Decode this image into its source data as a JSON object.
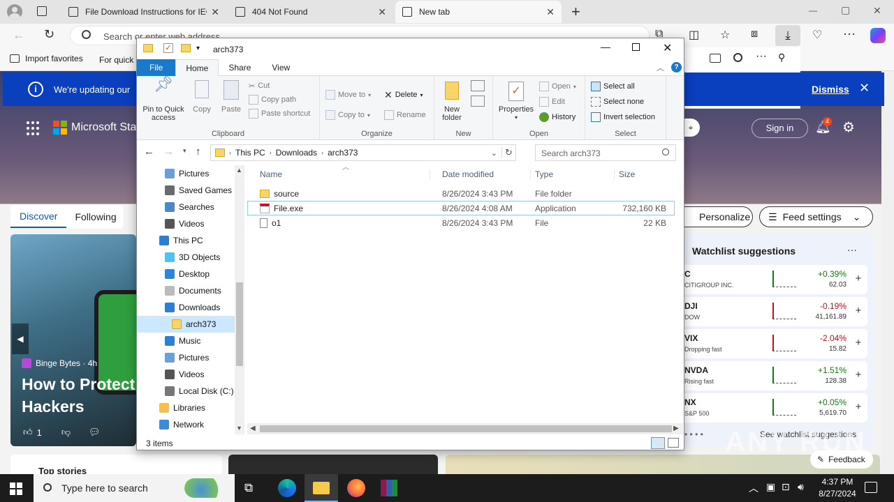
{
  "browser": {
    "tabs": [
      {
        "title": "File Download Instructions for IEC",
        "close": "✕"
      },
      {
        "title": "404 Not Found",
        "close": "✕"
      },
      {
        "title": "New tab",
        "close": "✕"
      }
    ],
    "new_tab_plus": "+",
    "address_placeholder": "Search or enter web address",
    "favorites": [
      {
        "label": "Import favorites"
      },
      {
        "label": "For quick"
      }
    ],
    "window_controls": {
      "minimize": "—",
      "maximize": "▢",
      "close": "✕"
    }
  },
  "newtab": {
    "update_text": "We're updating our",
    "dismiss": "Dismiss",
    "store_label": "Microsoft Sta",
    "sign_in": "Sign in",
    "notification_count": "4",
    "feed_tabs": [
      "Discover",
      "Following"
    ],
    "personalize": "Personalize",
    "feed_settings": "Feed settings",
    "article": {
      "source": "Binge Bytes · 4h",
      "headline_1": "How to Protect",
      "headline_2": "Hackers",
      "likes": "1"
    },
    "top_stories": "Top stories",
    "feedback": "Feedback",
    "watchlist": {
      "title": "Watchlist suggestions",
      "more": "···",
      "items": [
        {
          "symbol": "C",
          "name": "CITIGROUP INC.",
          "change": "+0.39%",
          "price": "62.03",
          "dir": "up"
        },
        {
          "symbol": "DJI",
          "name": "DOW",
          "change": "-0.19%",
          "price": "41,161.89",
          "dir": "down"
        },
        {
          "symbol": "VIX",
          "name": "Dropping fast",
          "change": "-2.04%",
          "price": "15.82",
          "dir": "down"
        },
        {
          "symbol": "NVDA",
          "name": "Rising fast",
          "change": "+1.51%",
          "price": "128.38",
          "dir": "up"
        },
        {
          "symbol": "NX",
          "name": "S&P 500",
          "change": "+0.05%",
          "price": "5,619.70",
          "dir": "up"
        }
      ],
      "see_more": "See watchlist suggestions"
    },
    "watermark": "ANY RUN",
    "colors": {
      "up": "#107c10",
      "down": "#c50f1f",
      "accent": "#0a3fbd"
    }
  },
  "explorer": {
    "title": "arch373",
    "ribbon_tabs": [
      "File",
      "Home",
      "Share",
      "View"
    ],
    "clipboard": {
      "pin": "Pin to Quick access",
      "copy": "Copy",
      "paste": "Paste",
      "cut": "Cut",
      "copy_path": "Copy path",
      "paste_shortcut": "Paste shortcut",
      "label": "Clipboard"
    },
    "organize": {
      "move_to": "Move to",
      "copy_to": "Copy to",
      "delete": "Delete",
      "rename": "Rename",
      "label": "Organize"
    },
    "new": {
      "new_folder": "New folder",
      "label": "New"
    },
    "open": {
      "properties": "Properties",
      "open": "Open",
      "edit": "Edit",
      "history": "History",
      "label": "Open"
    },
    "select": {
      "select_all": "Select all",
      "select_none": "Select none",
      "invert": "Invert selection",
      "label": "Select"
    },
    "breadcrumb": [
      "This PC",
      "Downloads",
      "arch373"
    ],
    "search_placeholder": "Search arch373",
    "tree": [
      {
        "label": "Pictures",
        "icon": "pictures-icon",
        "indent": 1
      },
      {
        "label": "Saved Games",
        "icon": "saved-games-icon",
        "indent": 1
      },
      {
        "label": "Searches",
        "icon": "searches-icon",
        "indent": 1
      },
      {
        "label": "Videos",
        "icon": "videos-icon",
        "indent": 1
      },
      {
        "label": "This PC",
        "icon": "this-pc-icon",
        "indent": 0
      },
      {
        "label": "3D Objects",
        "icon": "3d-objects-icon",
        "indent": 1
      },
      {
        "label": "Desktop",
        "icon": "desktop-icon",
        "indent": 1
      },
      {
        "label": "Documents",
        "icon": "documents-icon",
        "indent": 1
      },
      {
        "label": "Downloads",
        "icon": "downloads-icon",
        "indent": 1
      },
      {
        "label": "arch373",
        "icon": "folder-icon",
        "indent": 2,
        "selected": true
      },
      {
        "label": "Music",
        "icon": "music-icon",
        "indent": 1
      },
      {
        "label": "Pictures",
        "icon": "pictures-icon",
        "indent": 1
      },
      {
        "label": "Videos",
        "icon": "videos-icon",
        "indent": 1
      },
      {
        "label": "Local Disk (C:)",
        "icon": "local-disk-icon",
        "indent": 1
      },
      {
        "label": "Libraries",
        "icon": "libraries-icon",
        "indent": 0
      },
      {
        "label": "Network",
        "icon": "network-icon",
        "indent": 0
      }
    ],
    "columns": [
      "Name",
      "Date modified",
      "Type",
      "Size"
    ],
    "files": [
      {
        "name": "source",
        "date": "8/26/2024 3:43 PM",
        "type": "File folder",
        "size": "",
        "icon": "folder-icon"
      },
      {
        "name": "File.exe",
        "date": "8/26/2024 4:08 AM",
        "type": "Application",
        "size": "732,160 KB",
        "icon": "exe-icon",
        "focused": true
      },
      {
        "name": "o1",
        "date": "8/26/2024 3:43 PM",
        "type": "File",
        "size": "22 KB",
        "icon": "file-icon"
      }
    ],
    "status": "3 items"
  },
  "taskbar": {
    "search_placeholder": "Type here to search",
    "time": "4:37 PM",
    "date": "8/27/2024"
  }
}
